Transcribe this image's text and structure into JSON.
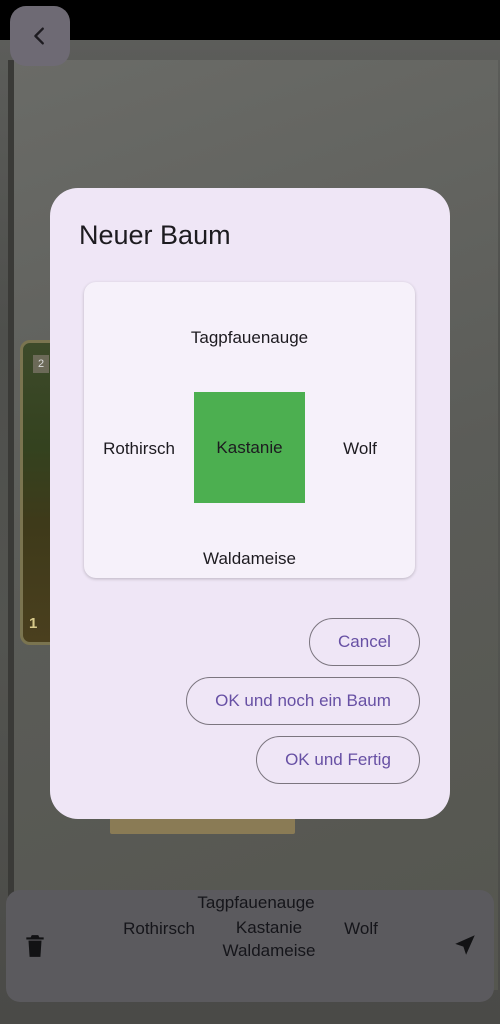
{
  "dialog": {
    "title": "Neuer Baum",
    "top": "Tagpfauenauge",
    "left": "Rothirsch",
    "center": "Kastanie",
    "right": "Wolf",
    "bottom": "Waldameise",
    "center_color": "#4caf50"
  },
  "buttons": {
    "cancel": "Cancel",
    "ok_more": "OK und noch ein Baum",
    "ok_done": "OK und Fertig"
  },
  "summary": {
    "top": "Tagpfauenauge",
    "left": "Rothirsch",
    "center": "Kastanie",
    "right": "Wolf",
    "bottom": "Waldameise"
  },
  "background_card": {
    "number": "2",
    "footer": "1"
  },
  "icons": {
    "back": "chevron-left-icon",
    "delete": "trash-icon",
    "send": "send-icon"
  },
  "colors": {
    "accent": "#6750a4",
    "dialog_bg": "#efe6f6"
  }
}
